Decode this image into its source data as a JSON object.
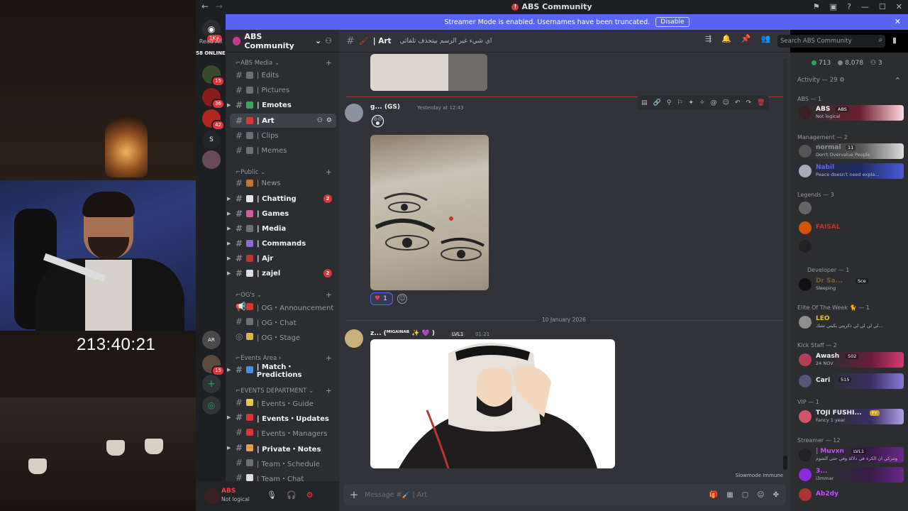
{
  "window": {
    "title": "ABS Community"
  },
  "stream": {
    "timer": "213:40:21"
  },
  "guild_bar": {
    "read_all": "Read All",
    "online_count": "58 ONLINE",
    "badges": {
      "top": "1K+",
      "g1": "15",
      "g2": "36",
      "g3": "42",
      "g4": "15"
    },
    "server_letter": "S",
    "avatar_tag": "AR"
  },
  "banner": {
    "text": "Streamer Mode is enabled. Usernames have been truncated.",
    "disable_label": "Disable"
  },
  "server": {
    "name": "ABS Community"
  },
  "sidebar": {
    "categories": {
      "media": "ABS Media",
      "public": "Public",
      "ogs": "OG's",
      "events_area": "Events Area",
      "events_dept": "EVENTS DEPARTMENT"
    },
    "channels": [
      {
        "label": "| Edits"
      },
      {
        "label": "| Pictures"
      },
      {
        "label": "| Emotes"
      },
      {
        "label": "| Art"
      },
      {
        "label": "| Clips"
      },
      {
        "label": "| Memes"
      },
      {
        "label": "| News"
      },
      {
        "label": "| Chatting",
        "badge": "2"
      },
      {
        "label": "| Games"
      },
      {
        "label": "| Media"
      },
      {
        "label": "| Commands"
      },
      {
        "label": "| Ajr"
      },
      {
        "label": "| zajel",
        "badge": "2"
      },
      {
        "label": "| OG・Announcement"
      },
      {
        "label": "| OG・Chat"
      },
      {
        "label": "| OG・Stage"
      },
      {
        "label": "| Match・Predictions"
      },
      {
        "label": "| Events・Guide"
      },
      {
        "label": "| Events・Updates"
      },
      {
        "label": "| Events・Managers"
      },
      {
        "label": "| Private・Notes"
      },
      {
        "label": "| Team・Schedule"
      },
      {
        "label": "| Team・Chat"
      }
    ]
  },
  "user": {
    "name": "ABS",
    "status": "Not logical"
  },
  "chat": {
    "channel": "| Art",
    "topic": "اي شيء غير الرسم بيتحذف تلقائي",
    "messages": [
      {
        "author": "g... (GS)",
        "time": "Yesterday at 12:43",
        "reaction_count": "1"
      },
      {
        "author": "z... (ᴹᴵᴳᴬᴵᴺᴬᴮ ✨ 💜 )",
        "level": "LVL1",
        "time": "01:21"
      }
    ],
    "date_divider": "10 January 2026",
    "slowmode": "Slowmode Immune",
    "composer_placeholder": "Message #🖌️ | Art"
  },
  "search": {
    "placeholder": "Search ABS Community"
  },
  "members": {
    "stats": {
      "online": "713",
      "total": "8,078",
      "third": "3"
    },
    "activity": "Activity — 29",
    "groups": [
      {
        "title": "ABS — 1"
      },
      {
        "title": "Management — 2"
      },
      {
        "title": "Legends — 3"
      },
      {
        "title": "Developer — 1"
      },
      {
        "title": "Elite Of The Week 🐈 — 1"
      },
      {
        "title": "Kick Staff — 2"
      },
      {
        "title": "VIP — 1"
      },
      {
        "title": "Streamer — 12"
      }
    ],
    "list": [
      {
        "name": "ABS",
        "sub": "Not logical",
        "tag": "ABS",
        "color": "#ffffff"
      },
      {
        "name": "normal",
        "sub": "Don't Overvalue People",
        "tag": "11",
        "color": "#8f8f8f"
      },
      {
        "name": "Nabil",
        "sub": "Peace doesn't need expla...",
        "color": "#5865f2"
      },
      {
        "name": "",
        "sub": "",
        "color": "#c0392b"
      },
      {
        "name": "FAISAL",
        "sub": "",
        "color": "#c0392b"
      },
      {
        "name": "",
        "sub": "",
        "color": "#c0392b"
      },
      {
        "name": "Dr Sa...",
        "sub": "Sleeping",
        "tag": "Sce",
        "color": "#7a5c2e"
      },
      {
        "name": "LEO",
        "sub": "لي لي لي لي ذكريتي بكيتي تشك...",
        "color": "#f0c419"
      },
      {
        "name": "Awash",
        "sub": "24 NOV",
        "tag": "502",
        "color": "#f2f3f5"
      },
      {
        "name": "Cari",
        "sub": "",
        "tag": "515",
        "color": "#f2f3f5"
      },
      {
        "name": "TOJI FUSHI...",
        "sub": "Fancy 1 year",
        "tag": "FY",
        "color": "#f2f3f5"
      },
      {
        "name": "| Muvxn",
        "sub": "وتتركي ان الكرة في دلالة وفي حتى الشوم",
        "tag": "LVL1",
        "color": "#c44dff"
      },
      {
        "name": "3...",
        "sub": "i3mmar",
        "color": "#c44dff"
      },
      {
        "name": "Ab2dy",
        "sub": "",
        "color": "#c44dff"
      }
    ]
  },
  "colors": {
    "blurple": "#5865f2",
    "danger": "#da373c",
    "bg": "#313338",
    "sidebar": "#2b2d31",
    "online": "#23a55a"
  }
}
